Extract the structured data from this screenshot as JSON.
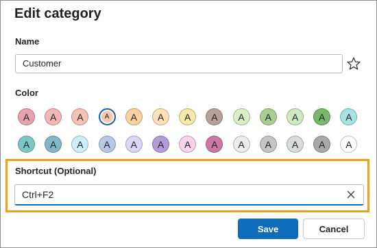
{
  "dialog": {
    "title": "Edit category",
    "name_label": "Name",
    "name_value": "Customer",
    "favorite_icon": "star-outline-icon",
    "color_label": "Color",
    "swatch_letter": "A",
    "swatches": [
      {
        "color": "#e6a3ae",
        "selected": false
      },
      {
        "color": "#f3b6b6",
        "selected": false
      },
      {
        "color": "#f6c2b6",
        "selected": false
      },
      {
        "color": "#f7c8a8",
        "selected": true
      },
      {
        "color": "#fbd0a0",
        "selected": false
      },
      {
        "color": "#fde2b6",
        "selected": false
      },
      {
        "color": "#f7e8a7",
        "selected": false
      },
      {
        "color": "#b9a199",
        "selected": false
      },
      {
        "color": "#dbefc6",
        "selected": false
      },
      {
        "color": "#a8cf8f",
        "selected": false
      },
      {
        "color": "#cde9c2",
        "selected": false
      },
      {
        "color": "#7ab96c",
        "selected": false
      },
      {
        "color": "#a6e3e3",
        "selected": false
      },
      {
        "color": "#7cc7c5",
        "selected": false
      },
      {
        "color": "#81b5c7",
        "selected": false
      },
      {
        "color": "#cdeef8",
        "selected": false
      },
      {
        "color": "#b5c9e6",
        "selected": false
      },
      {
        "color": "#dcd6f6",
        "selected": false
      },
      {
        "color": "#b49ad6",
        "selected": false
      },
      {
        "color": "#f9d3ec",
        "selected": false
      },
      {
        "color": "#cc77a7",
        "selected": false
      },
      {
        "color": "#ececec",
        "selected": false
      },
      {
        "color": "#c5c5c5",
        "selected": false
      },
      {
        "color": "#d8dcdd",
        "selected": false
      },
      {
        "color": "#a8a8a8",
        "selected": false
      },
      {
        "color": "#ffffff",
        "selected": false
      }
    ],
    "shortcut_label": "Shortcut (Optional)",
    "shortcut_value": "Ctrl+F2",
    "clear_icon": "close-icon",
    "save_label": "Save",
    "cancel_label": "Cancel",
    "accent_color": "#0f6cbd",
    "highlight_color": "#e8a21b"
  }
}
